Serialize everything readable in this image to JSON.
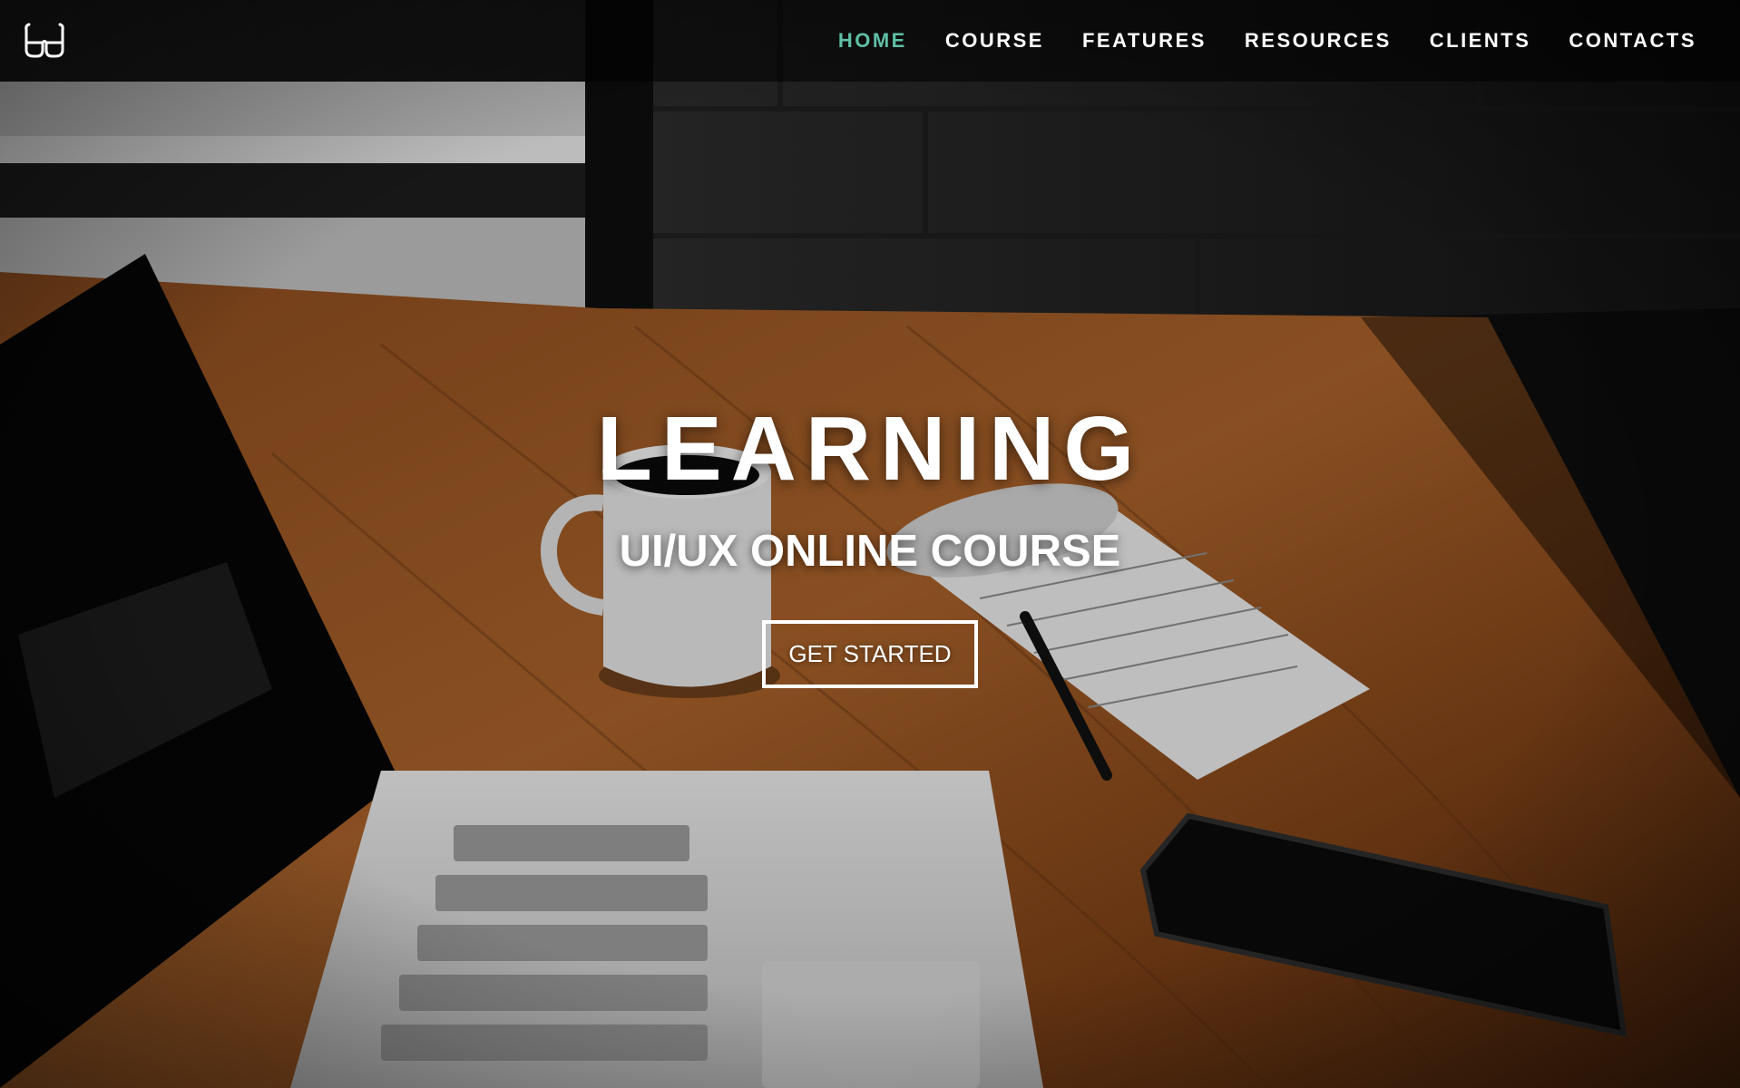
{
  "header": {
    "logo_icon": "glasses-icon",
    "nav": [
      {
        "label": "HOME",
        "active": true
      },
      {
        "label": "COURSE",
        "active": false
      },
      {
        "label": "FEATURES",
        "active": false
      },
      {
        "label": "RESOURCES",
        "active": false
      },
      {
        "label": "CLIENTS",
        "active": false
      },
      {
        "label": "CONTACTS",
        "active": false
      }
    ]
  },
  "hero": {
    "title": "LEARNING",
    "subtitle": "UI/UX ONLINE COURSE",
    "cta_label": "GET STARTED"
  },
  "colors": {
    "accent": "#5fbfa6",
    "text": "#ffffff",
    "nav_bg": "rgba(0,0,0,0.55)"
  }
}
